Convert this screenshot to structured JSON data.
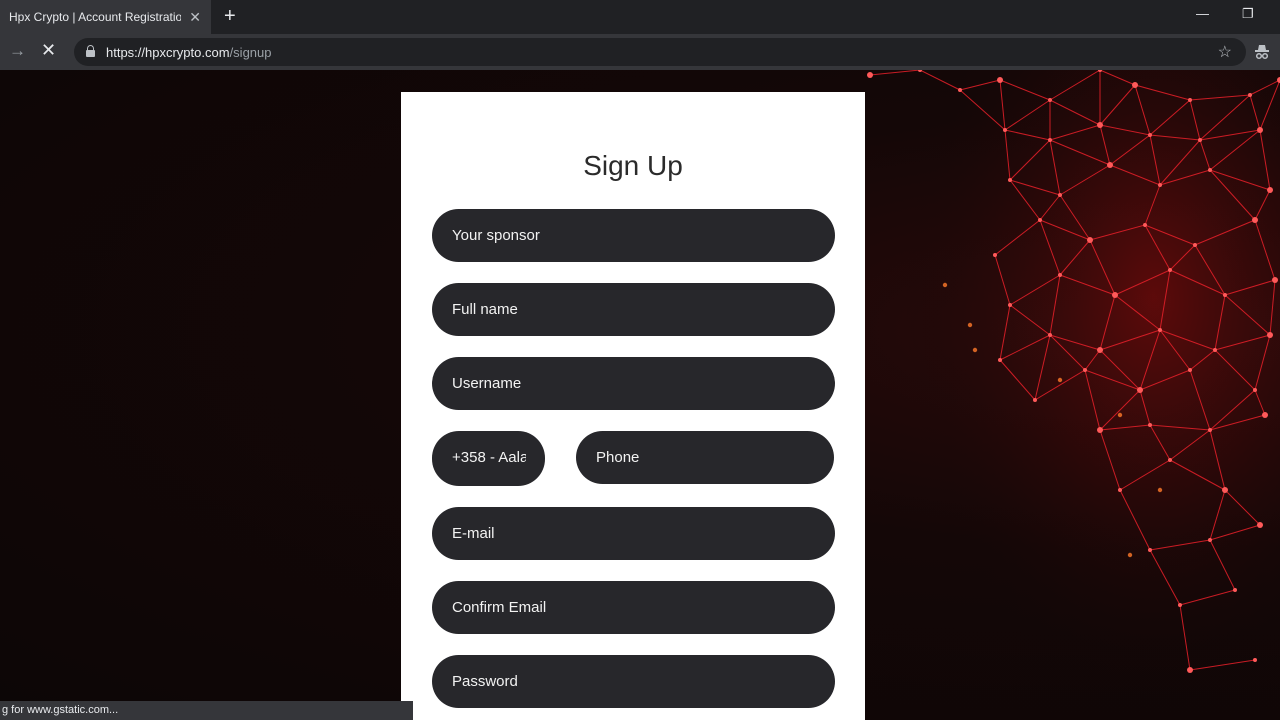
{
  "browser": {
    "tab_title": "Hpx Crypto | Account Registratio",
    "url_host": "https://hpxcrypto.com",
    "url_path": "/signup",
    "status_text": "g for www.gstatic.com..."
  },
  "form": {
    "title": "Sign Up",
    "sponsor_placeholder": "Your sponsor",
    "fullname_placeholder": "Full name",
    "username_placeholder": "Username",
    "country_code_value": "+358 - Aala",
    "phone_placeholder": "Phone",
    "email_placeholder": "E-mail",
    "confirm_email_placeholder": "Confirm Email",
    "password_placeholder": "Password"
  },
  "icons": {
    "forward": "arrow-right-icon",
    "stop": "close-icon",
    "lock": "lock-icon",
    "bookmark": "star-icon",
    "tab_close": "close-icon",
    "new_tab": "plus-icon"
  },
  "colors": {
    "field_bg": "#27272b",
    "accent_red": "#ff2a2a",
    "card_bg": "#ffffff"
  }
}
